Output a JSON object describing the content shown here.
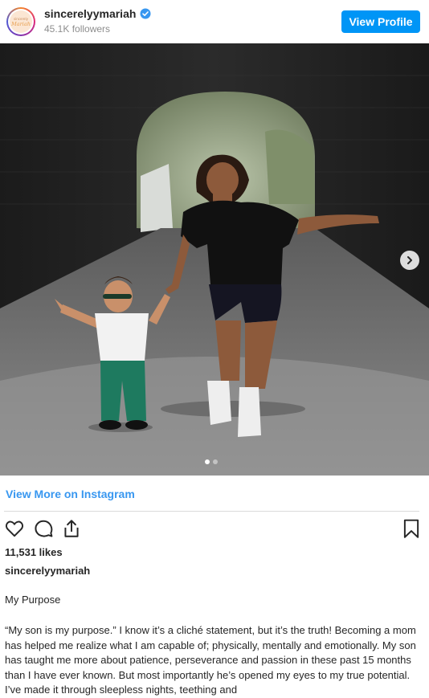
{
  "header": {
    "username": "sincerelyymariah",
    "followers": "45.1K followers",
    "view_profile_label": "View Profile",
    "avatar_text": "sincerely Mariah"
  },
  "post": {
    "image_alt": "Mother and toddler holding hands walking on a road inside a tunnel",
    "carousel": {
      "current": 1,
      "total": 2
    }
  },
  "footer": {
    "view_more_label": "View More on Instagram",
    "likes": "11,531 likes",
    "caption_username": "sincerelyymariah",
    "caption_title": "My Purpose",
    "caption_body": "“My son is my purpose.” I know it’s a cliché statement, but it’s the truth! Becoming a mom has helped me realize what I am capable of; physically, mentally and emotionally. My son has taught me more about patience, perseverance and passion in these past 15 months than I have ever known. But most importantly he’s opened my eyes to my true potential. I’ve made it through sleepless nights, teething and"
  },
  "icons": [
    "verified-badge-icon",
    "heart-icon",
    "comment-icon",
    "share-icon",
    "bookmark-icon",
    "chevron-right-icon"
  ],
  "colors": {
    "accent": "#0095f6",
    "link": "#3897f0",
    "text": "#262626",
    "muted": "#8e8e8e"
  }
}
